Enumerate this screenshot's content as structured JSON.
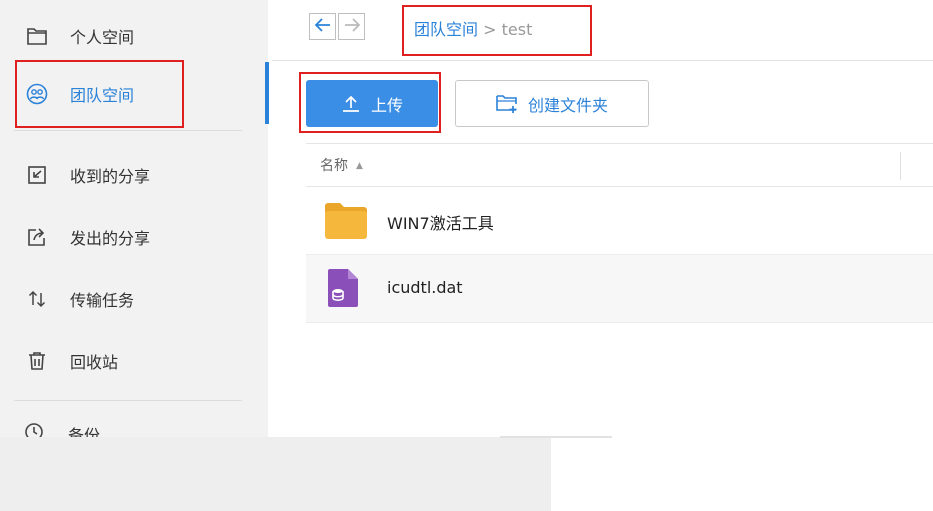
{
  "sidebar": {
    "items": [
      {
        "label": "个人空间",
        "icon": "folder-icon"
      },
      {
        "label": "团队空间",
        "icon": "team-icon",
        "active": true
      },
      {
        "label": "收到的分享",
        "icon": "received-share-icon"
      },
      {
        "label": "发出的分享",
        "icon": "sent-share-icon"
      },
      {
        "label": "传输任务",
        "icon": "transfer-icon"
      },
      {
        "label": "回收站",
        "icon": "trash-icon"
      }
    ],
    "clipped_item": {
      "label": "备份",
      "icon": "clock-icon"
    }
  },
  "breadcrumb": {
    "root": "团队空间",
    "separator": ">",
    "current": "test"
  },
  "toolbar": {
    "upload_label": "上传",
    "new_folder_label": "创建文件夹"
  },
  "file_list": {
    "header_name": "名称",
    "sort_indicator": "▲",
    "files": [
      {
        "name": "WIN7激活工具",
        "type": "folder"
      },
      {
        "name": "icudtl.dat",
        "type": "file"
      }
    ]
  },
  "colors": {
    "accent": "#2b82d9",
    "upload_button": "#3a8ee6",
    "highlight_box": "#e02020",
    "folder": "#f5b83d",
    "file_icon": "#8a4fb8"
  }
}
